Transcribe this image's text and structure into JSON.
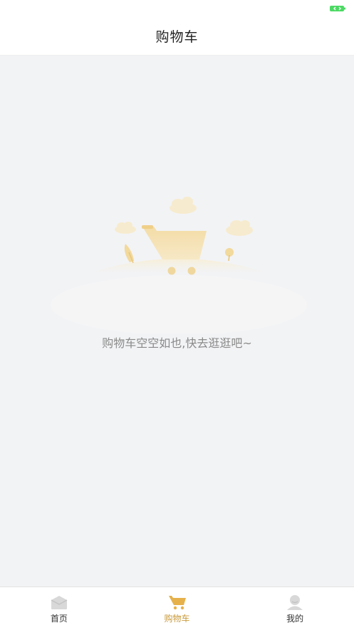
{
  "header": {
    "title": "购物车"
  },
  "empty_state": {
    "message": "购物车空空如也,快去逛逛吧~",
    "illustration_icon": "empty-cart-illustration"
  },
  "tabs": [
    {
      "label": "首页",
      "icon": "home-icon",
      "active": false
    },
    {
      "label": "购物车",
      "icon": "cart-icon",
      "active": true
    },
    {
      "label": "我的",
      "icon": "user-icon",
      "active": false
    }
  ],
  "colors": {
    "accent": "#c89a3c",
    "background": "#f2f3f5",
    "battery": "#4cd964"
  }
}
